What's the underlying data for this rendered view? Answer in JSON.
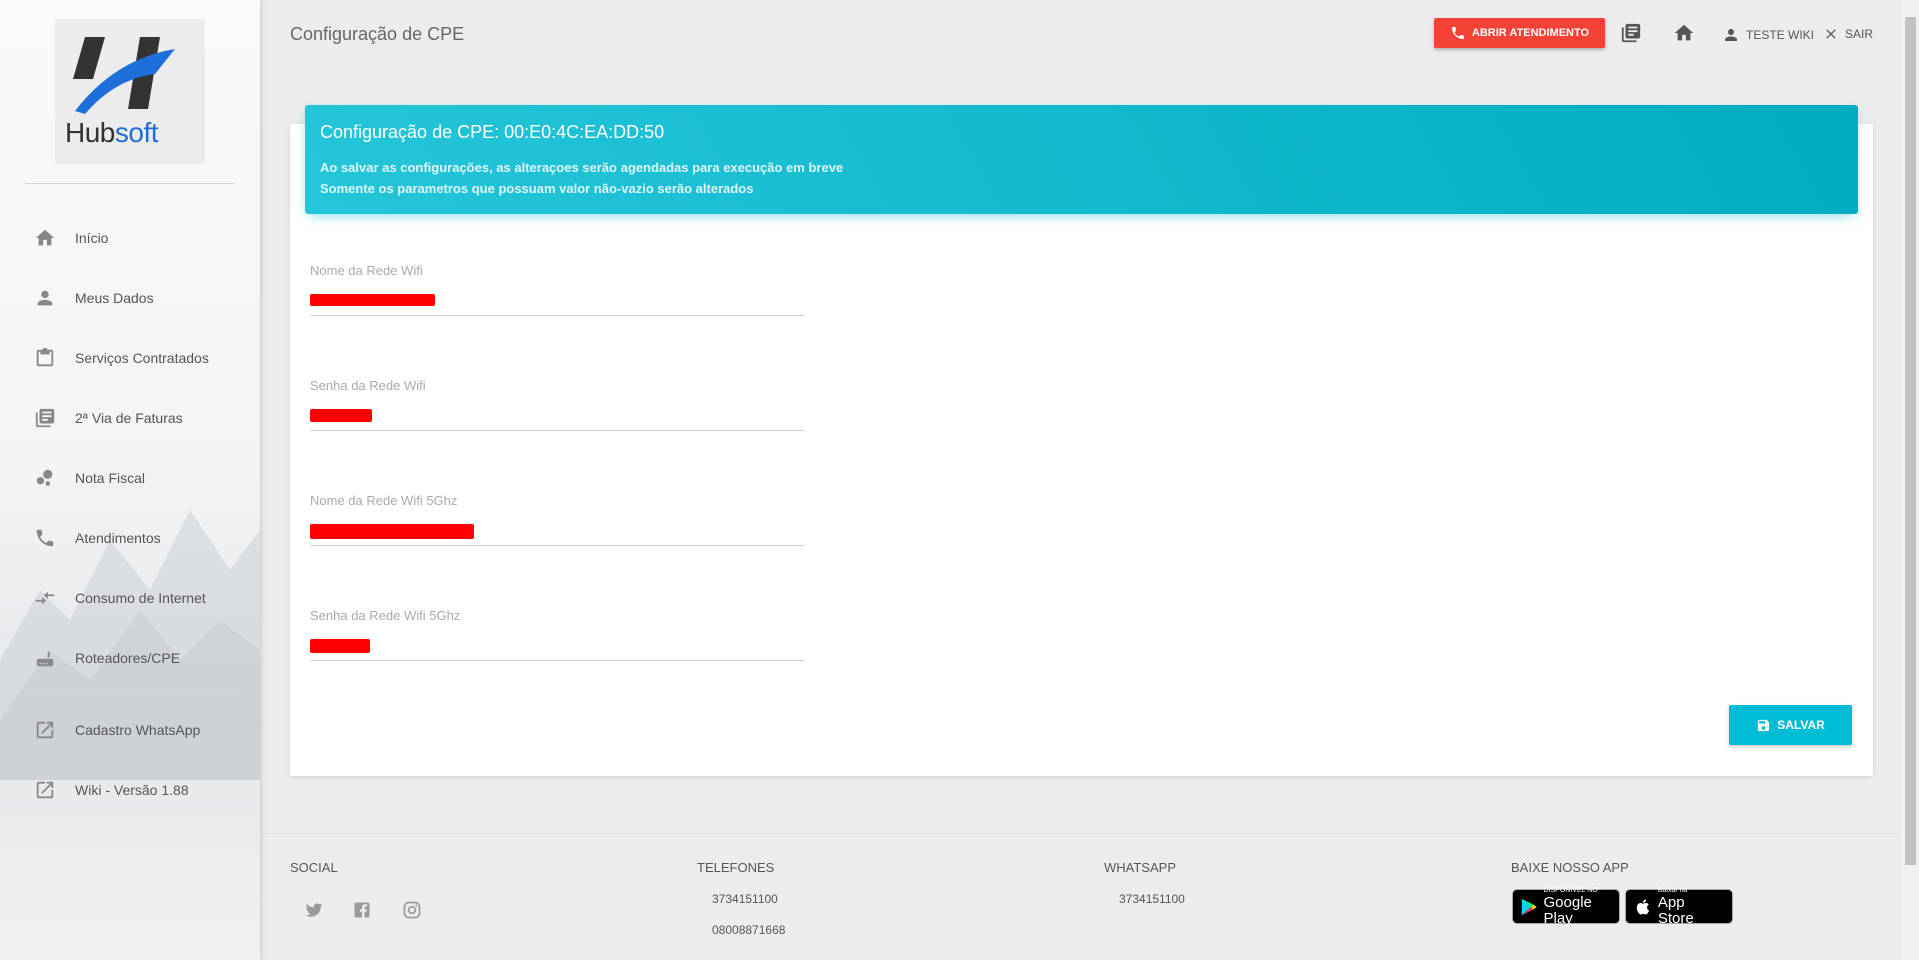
{
  "logo": {
    "text_main": "Hub",
    "text_accent": "soft"
  },
  "sidebar": {
    "items": [
      {
        "label": "Início",
        "icon": "home-icon"
      },
      {
        "label": "Meus Dados",
        "icon": "person-icon"
      },
      {
        "label": "Serviços Contratados",
        "icon": "clipboard-icon"
      },
      {
        "label": "2ª Via de Faturas",
        "icon": "library-books-icon"
      },
      {
        "label": "Nota Fiscal",
        "icon": "bubble-chart-icon"
      },
      {
        "label": "Atendimentos",
        "icon": "phone-icon"
      },
      {
        "label": "Consumo de Internet",
        "icon": "compare-arrows-icon"
      },
      {
        "label": "Roteadores/CPE",
        "icon": "router-icon"
      }
    ],
    "external_items": [
      {
        "label": "Cadastro WhatsApp",
        "icon": "open-in-new-icon"
      },
      {
        "label": "Wiki - Versão 1.88",
        "icon": "open-in-new-icon"
      }
    ]
  },
  "header": {
    "title": "Configuração de CPE",
    "open_ticket_label": "ABRIR ATENDIMENTO",
    "user_label": "TESTE WIKI",
    "logout_label": "SAIR",
    "accent_color": "#f44336"
  },
  "card": {
    "title": "Configuração de CPE: 00:E0:4C:EA:DD:50",
    "info_line_1": "Ao salvar as configurações, as alteraçoes serão agendadas para execução em breve",
    "info_line_2": "Somente os parametros que possuam valor não-vazio serão alterados",
    "header_color": "#00bcd4"
  },
  "form": {
    "fields": [
      {
        "label": "Nome da Rede Wifi",
        "value": "",
        "redacted": true
      },
      {
        "label": "Senha da Rede Wifi",
        "value": "",
        "redacted": true
      },
      {
        "label": "Nome da Rede Wifi 5Ghz",
        "value": "",
        "redacted": true
      },
      {
        "label": "Senha da Rede Wifi 5Ghz",
        "value": "",
        "redacted": true
      }
    ],
    "save_label": "SALVAR"
  },
  "footer": {
    "social_title": "SOCIAL",
    "social_icons": [
      "twitter-icon",
      "facebook-icon",
      "instagram-icon"
    ],
    "phones_title": "TELEFONES",
    "phones": [
      "3734151100",
      "08008871668"
    ],
    "whatsapp_title": "WHATSAPP",
    "whatsapp": "3734151100",
    "app_title": "BAIXE NOSSO APP",
    "google_play_small": "DISPONÍVEL NO",
    "google_play_big": "Google Play",
    "app_store_small": "Baixar na",
    "app_store_big": "App Store"
  }
}
